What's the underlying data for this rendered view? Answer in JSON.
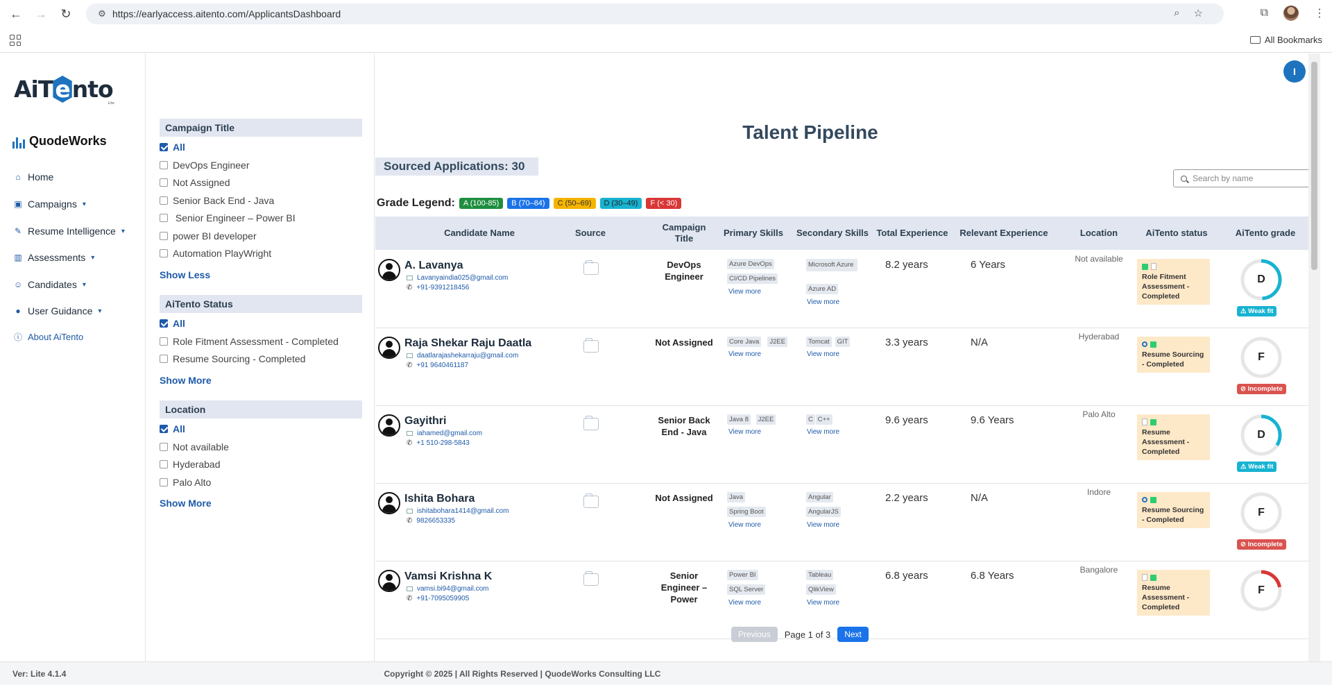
{
  "browser": {
    "url": "https://earlyaccess.aitento.com/ApplicantsDashboard",
    "bookmarks_label": "All Bookmarks"
  },
  "brand": {
    "logo_text_pre": "AiT",
    "logo_text_hex": "e",
    "logo_text_post": "nto",
    "logo_sub": "Lite",
    "company": "QuodeWorks"
  },
  "nav": {
    "items": [
      {
        "label": "Home",
        "icon": "home-icon"
      },
      {
        "label": "Campaigns",
        "icon": "briefcase-icon"
      },
      {
        "label": "Resume Intelligence",
        "icon": "resume-icon"
      },
      {
        "label": "Assessments",
        "icon": "assessment-icon"
      },
      {
        "label": "Candidates",
        "icon": "users-icon"
      },
      {
        "label": "User Guidance",
        "icon": "bulb-icon"
      },
      {
        "label": "About AiTento",
        "icon": "info-icon"
      }
    ]
  },
  "filters": {
    "campaign": {
      "title": "Campaign Title",
      "options": [
        "All",
        "DevOps Engineer",
        "Not Assigned",
        "Senior Back End - Java",
        " Senior Engineer – Power BI",
        "power BI developer",
        "Automation PlayWright"
      ],
      "toggle": "Show Less"
    },
    "status": {
      "title": "AiTento Status",
      "options": [
        "All",
        "Role Fitment Assessment - Completed",
        "Resume Sourcing - Completed"
      ],
      "toggle": "Show More"
    },
    "location": {
      "title": "Location",
      "options": [
        "All",
        "Not available",
        "Hyderabad",
        "Palo Alto"
      ],
      "toggle": "Show More"
    }
  },
  "main": {
    "user_initial": "I",
    "title": "Talent Pipeline",
    "sourced": "Sourced Applications: 30",
    "search_placeholder": "Search by name",
    "legend": {
      "label": "Grade Legend:",
      "items": [
        {
          "label": "A (100-85)",
          "color": "#1e8e3e"
        },
        {
          "label": "B (70–84)",
          "color": "#1a73e8"
        },
        {
          "label": "C (50–69)",
          "color": "#f5b400"
        },
        {
          "label": "D (30–49)",
          "color": "#17b3d1"
        },
        {
          "label": "F (< 30)",
          "color": "#d93636"
        }
      ]
    },
    "columns": [
      "Candidate Name",
      "Source",
      "Campaign Title",
      "Primary Skills",
      "Secondary Skills",
      "Total Experience",
      "Relevant Experience",
      "Location",
      "AiTento status",
      "AiTento grade"
    ],
    "rows": [
      {
        "name": "A. Lavanya",
        "email": "Lavanyaindia025@gmail.com",
        "phone": "+91-9391218456",
        "campaign": "DevOps Engineer",
        "primary": [
          "Azure DevOps",
          "CI/CD Pipelines"
        ],
        "primary_more": "View more",
        "secondary": [
          "Microsoft Azure",
          "Azure AD"
        ],
        "secondary_more": "View more",
        "total_exp": "8.2 years",
        "relevant_exp": "6 Years",
        "location": "Not available",
        "status": "Role Fitment Assessment - Completed",
        "status_icons": [
          "check",
          "doc"
        ],
        "grade": "D",
        "grade_score": 49,
        "grade_color": "#17b3d1",
        "badge": "⚠ Weak fit",
        "badge_color": "#17b3d1"
      },
      {
        "name": "Raja Shekar Raju Daatla",
        "email": "daatlarajashekarraju@gmail.com",
        "phone": "+91 9640461187",
        "campaign": "Not Assigned",
        "primary": [
          "Core Java",
          "J2EE"
        ],
        "primary_more": "View more",
        "secondary": [
          "Tomcat",
          "GIT"
        ],
        "secondary_more": "View more",
        "total_exp": "3.3 years",
        "relevant_exp": "N/A",
        "location": "Hyderabad",
        "status": "Resume Sourcing - Completed",
        "status_icons": [
          "glass",
          "check"
        ],
        "grade": "F",
        "grade_score": 0,
        "grade_color": "#d93636",
        "badge": "⊘ Incomplete",
        "badge_color": "#d9534f"
      },
      {
        "name": "Gayithri",
        "email": "iahamed@gmail.com",
        "phone": "+1 510-298-5843",
        "campaign": "Senior Back End - Java",
        "primary": [
          "Java 8",
          "J2EE"
        ],
        "primary_more": "View more",
        "secondary": [
          "C",
          "C++"
        ],
        "secondary_more": "View more",
        "total_exp": "9.6 years",
        "relevant_exp": "9.6 Years",
        "location": "Palo Alto",
        "status": "Resume Assessment - Completed",
        "status_icons": [
          "doc",
          "check"
        ],
        "grade": "D",
        "grade_score": 34,
        "grade_color": "#17b3d1",
        "badge": "⚠ Weak fit",
        "badge_color": "#17b3d1"
      },
      {
        "name": "Ishita Bohara",
        "email": "ishitabohara1414@gmail.com",
        "phone": "9826653335",
        "campaign": "Not Assigned",
        "primary": [
          "Java",
          "Spring Boot"
        ],
        "primary_more": "View more",
        "secondary": [
          "Angular",
          "AngularJS"
        ],
        "secondary_more": "View more",
        "total_exp": "2.2 years",
        "relevant_exp": "N/A",
        "location": "Indore",
        "status": "Resume Sourcing - Completed",
        "status_icons": [
          "glass",
          "check"
        ],
        "grade": "F",
        "grade_score": 0,
        "grade_color": "#d93636",
        "badge": "⊘ Incomplete",
        "badge_color": "#d9534f"
      },
      {
        "name": "Vamsi Krishna K",
        "email": "vamsi.bi94@gmail.com",
        "phone": "+91-7095059905",
        "campaign": "Senior Engineer – Power",
        "primary": [
          "Power BI",
          "SQL Server"
        ],
        "primary_more": "View more",
        "secondary": [
          "Tableau",
          "QlikView"
        ],
        "secondary_more": "View more",
        "total_exp": "6.8 years",
        "relevant_exp": "6.8 Years",
        "location": "Bangalore",
        "status": "Resume Assessment - Completed",
        "status_icons": [
          "doc",
          "check"
        ],
        "grade": "F",
        "grade_score": 22,
        "grade_color": "#d93636",
        "badge": "",
        "badge_color": "#d9534f"
      }
    ],
    "pager": {
      "prev": "Previous",
      "info": "Page 1 of 3",
      "next": "Next"
    }
  },
  "footer": {
    "version": "Ver: Lite 4.1.4",
    "copyright": "Copyright © 2025 | All Rights Reserved | QuodeWorks Consulting LLC"
  }
}
